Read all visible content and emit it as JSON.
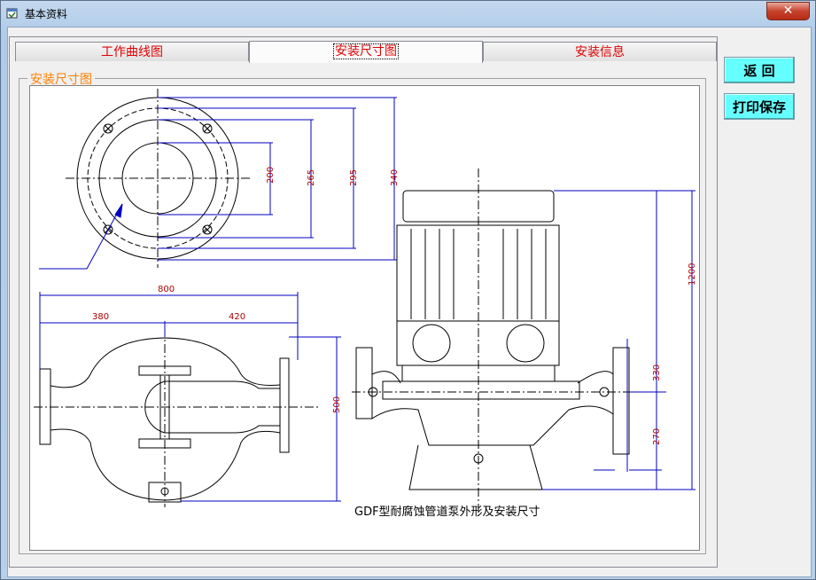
{
  "window": {
    "title": "基本资料",
    "close_glyph": "✕"
  },
  "tabs": [
    {
      "label": "工作曲线图"
    },
    {
      "label": "安装尺寸图"
    },
    {
      "label": "安装信息"
    }
  ],
  "group_label": "安装尺寸图",
  "buttons": {
    "back": "返  回",
    "print_save": "打印保存"
  },
  "drawing": {
    "caption": "GDF型耐腐蚀管道泵外形及安装尺寸",
    "dims": {
      "d200": "200",
      "d265": "265",
      "d295": "295",
      "d340": "340",
      "w800": "800",
      "w380": "380",
      "w420": "420",
      "h500": "500",
      "h1200": "1200",
      "h330": "330",
      "h270": "270"
    }
  }
}
